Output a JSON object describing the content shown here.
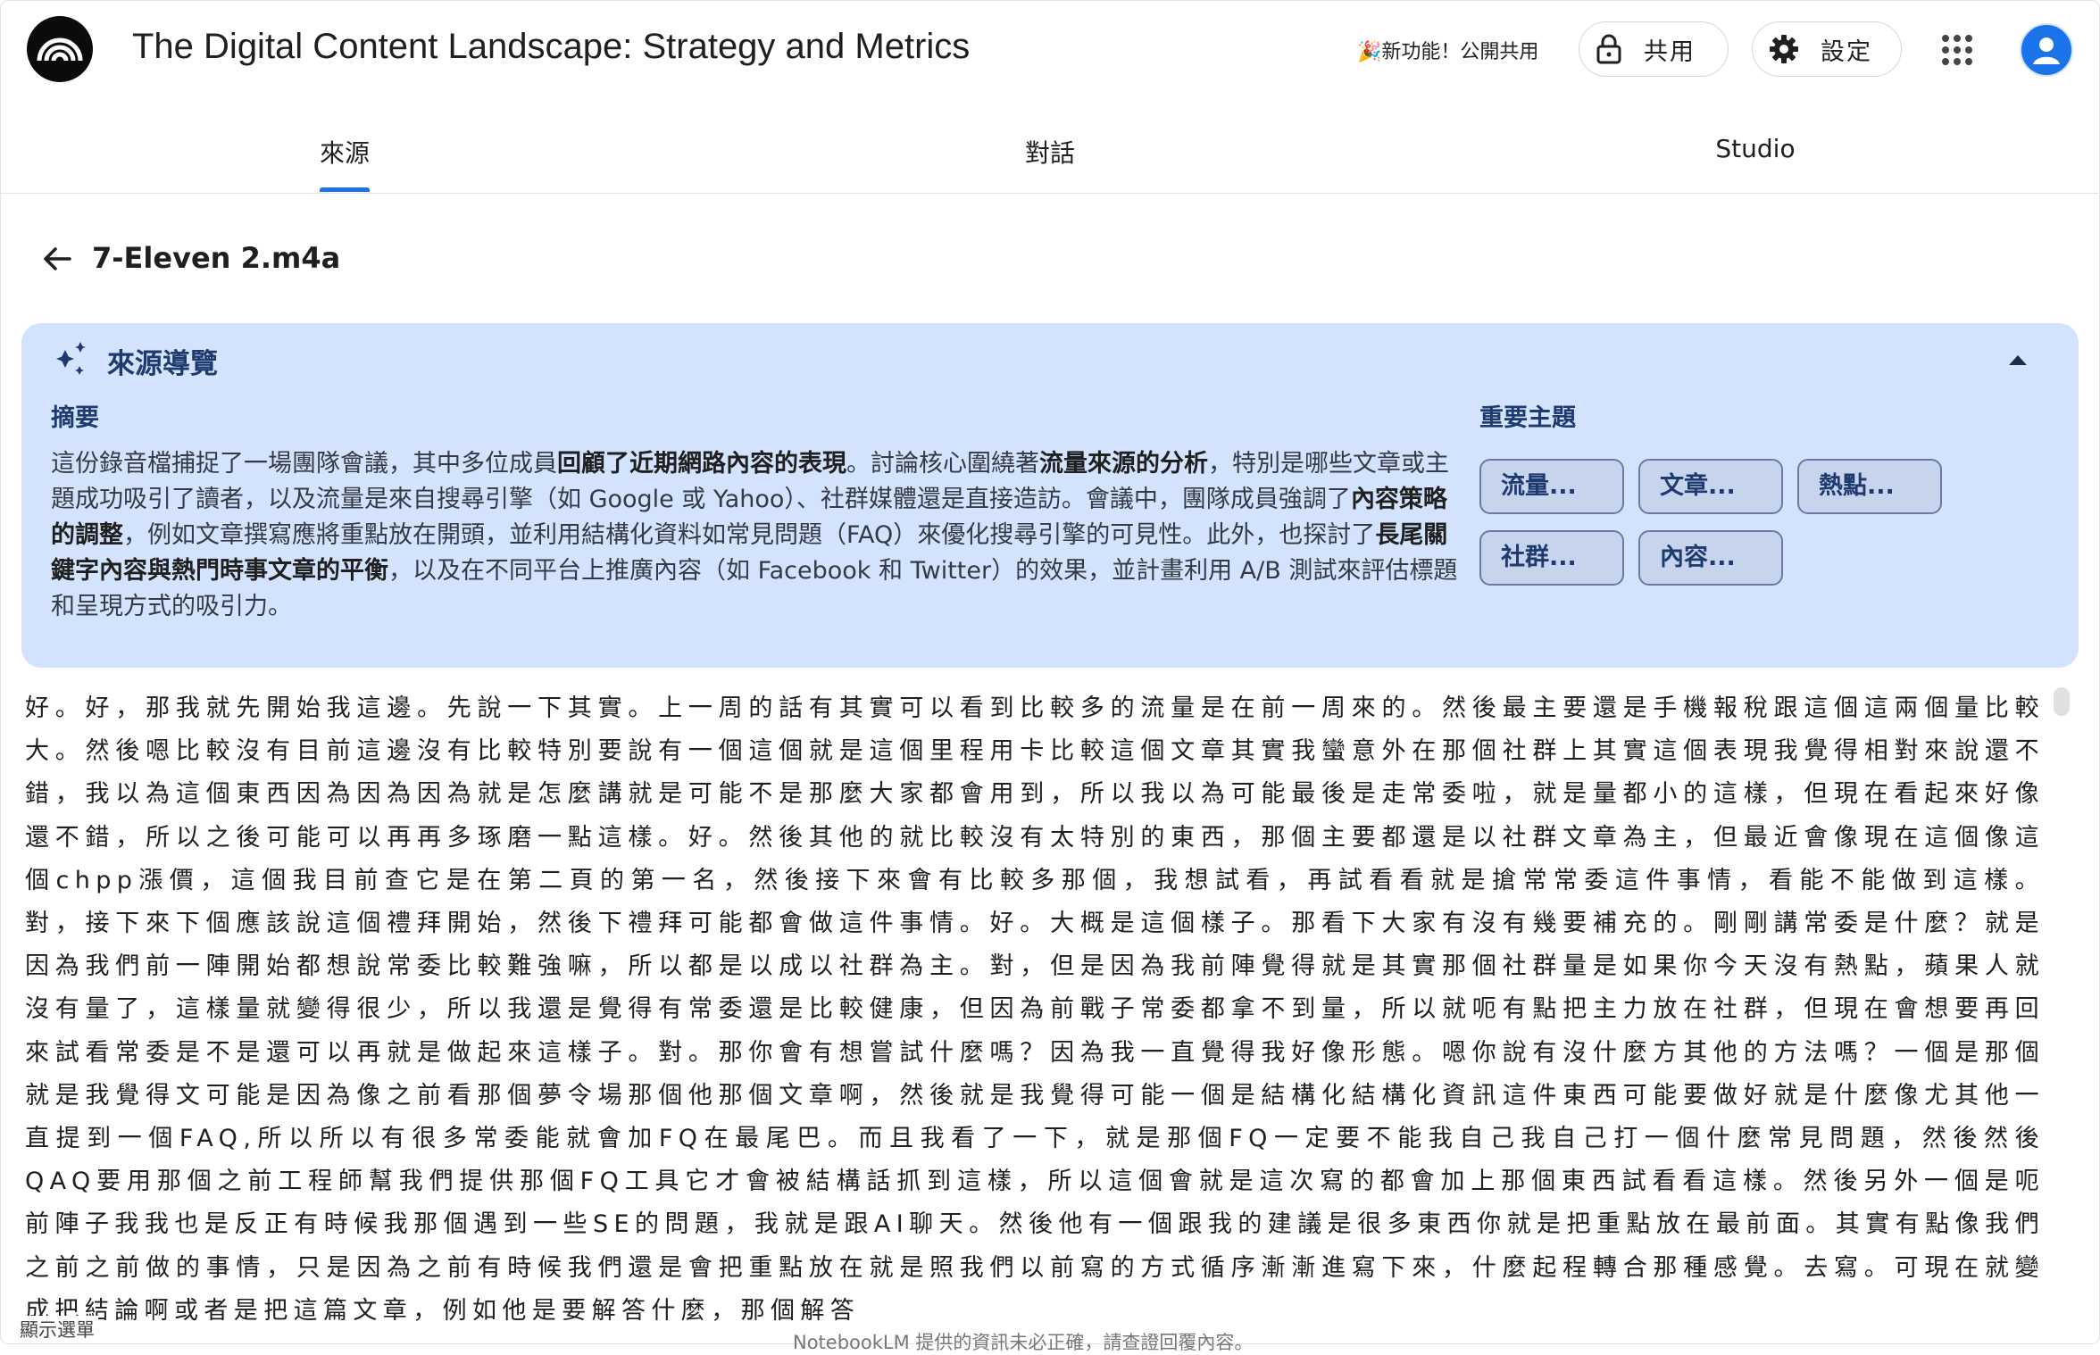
{
  "header": {
    "title": "The Digital Content Landscape: Strategy and Metrics",
    "promo": "🎉新功能！公開共用",
    "share_label": "共用",
    "settings_label": "設定"
  },
  "tabs": [
    {
      "label": "來源",
      "active": true
    },
    {
      "label": "對話",
      "active": false
    },
    {
      "label": "Studio",
      "active": false
    }
  ],
  "source": {
    "name": "7-Eleven 2.m4a"
  },
  "guide": {
    "title": "來源導覽",
    "summary_heading": "摘要",
    "summary_parts": [
      "這份錄音檔捕捉了一場團隊會議，其中多位成員",
      "回顧了近期網路內容的表現",
      "。討論核心圍繞著",
      "流量來源的分析",
      "，特別是哪些文章或主題成功吸引了讀者，以及流量是來自搜尋引擎（如 Google 或 Yahoo）、社群媒體還是直接造訪。會議中，團隊成員強調了",
      "內容策略的調整",
      "，例如文章撰寫應將重點放在開頭，並利用結構化資料如常見問題（FAQ）來優化搜尋引擎的可見性。此外，也探討了",
      "長尾關鍵字內容與熱門時事文章的平衡",
      "，以及在不同平台上推廣內容（如 Facebook 和 Twitter）的效果，並計畫利用 A/B 測試來評估標題和呈現方式的吸引力。"
    ],
    "topics_heading": "重要主題",
    "topics": [
      "流量...",
      "文章...",
      "熱點...",
      "社群...",
      "內容..."
    ]
  },
  "transcript": "好。好，那我就先開始我這邊。先說一下其實。上一周的話有其實可以看到比較多的流量是在前一周來的。然後最主要還是手機報稅跟這個這兩個量比較大。然後嗯比較沒有目前這邊沒有比較特別要說有一個這個就是這個里程用卡比較這個文章其實我蠻意外在那個社群上其實這個表現我覺得相對來說還不錯，我以為這個東西因為因為因為就是怎麼講就是可能不是那麼大家都會用到，所以我以為可能最後是走常委啦，就是量都小的這樣，但現在看起來好像還不錯，所以之後可能可以再再多琢磨一點這樣。好。然後其他的就比較沒有太特別的東西，那個主要都還是以社群文章為主，但最近會像現在這個像這個chpp漲價，這個我目前查它是在第二頁的第一名，然後接下來會有比較多那個，我想試看，再試看看就是搶常常委這件事情，看能不能做到這樣。對，接下來下個應該說這個禮拜開始，然後下禮拜可能都會做這件事情。好。大概是這個樣子。那看下大家有沒有幾要補充的。剛剛講常委是什麼？就是因為我們前一陣開始都想說常委比較難強嘛，所以都是以成以社群為主。對，但是因為我前陣覺得就是其實那個社群量是如果你今天沒有熱點，蘋果人就沒有量了，這樣量就變得很少，所以我還是覺得有常委還是比較健康，但因為前戰子常委都拿不到量，所以就呃有點把主力放在社群，但現在會想要再回來試看常委是不是還可以再就是做起來這樣子。對。那你會有想嘗試什麼嗎？因為我一直覺得我好像形態。嗯你說有沒什麼方其他的方法嗎？一個是那個就是我覺得文可能是因為像之前看那個夢令場那個他那個文章啊，然後就是我覺得可能一個是結構化結構化資訊這件東西可能要做好就是什麼像尤其他一直提到一個FAQ,所以所以有很多常委能就會加FQ在最尾巴。而且我看了一下，就是那個FQ一定要不能我自己我自己打一個什麼常見問題，然後然後QAQ要用那個之前工程師幫我們提供那個FQ工具它才會被結構話抓到這樣，所以這個會就是這次寫的都會加上那個東西試看看這樣。然後另外一個是呃前陣子我我也是反正有時候我那個遇到一些SE的問題，我就是跟AI聊天。然後他有一個跟我的建議是很多東西你就是把重點放在最前面。其實有點像我們之前之前做的事情，只是因為之前有時候我們還是會把重點放在就是照我們以前寫的方式循序漸漸進寫下來，什麼起程轉合那種感覺。去寫。可現在就變成把結論啊或者是把這篇文章，例如他是要解答什麼，那個解答",
  "footer": {
    "menu_label": "顯示選單",
    "disclaimer": "NotebookLM 提供的資訊未必正確，請查證回覆內容。"
  },
  "colors": {
    "accent": "#1a73e8",
    "guide_bg": "#d3e3fd",
    "chip_bg": "#c6d4ee"
  }
}
